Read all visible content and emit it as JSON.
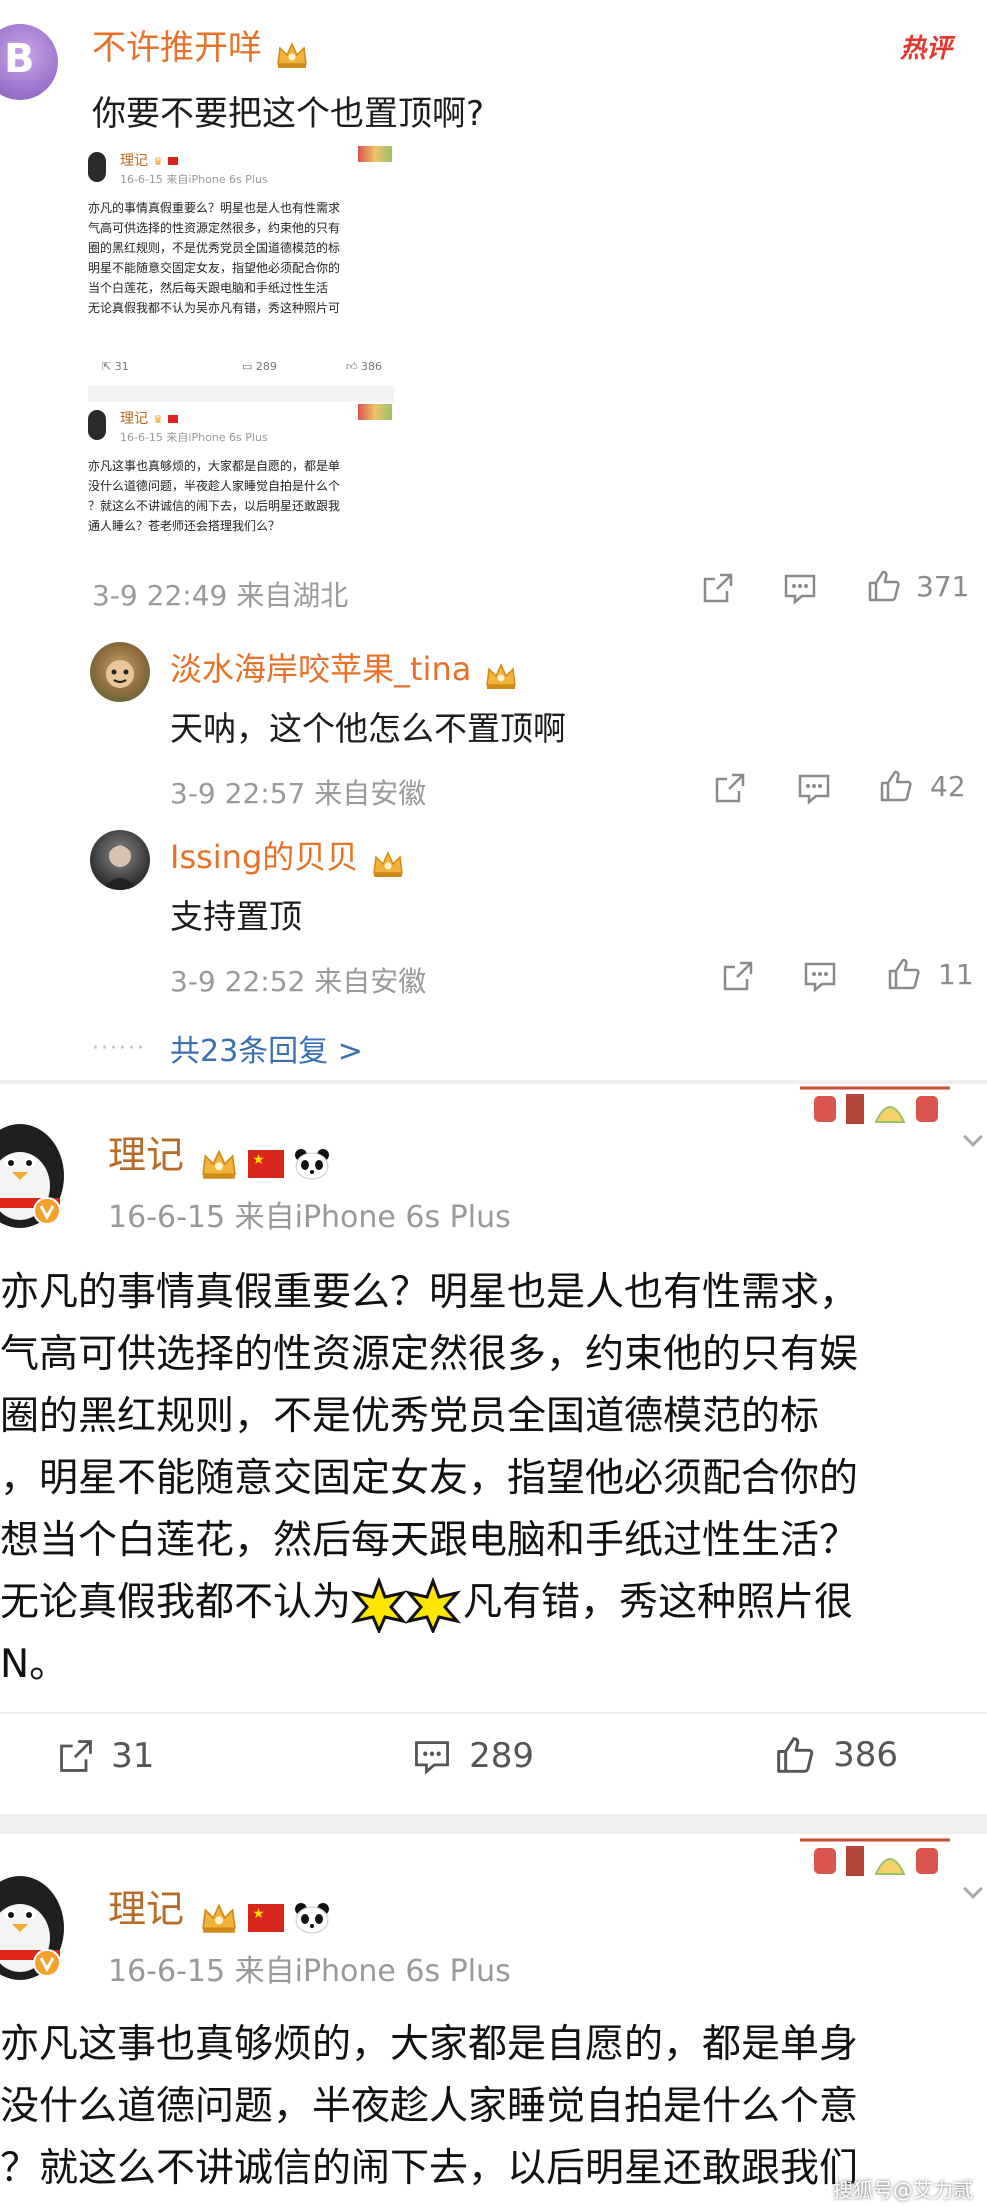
{
  "comment": {
    "avatar_letter": "B",
    "username": "不许推开咩",
    "hot_tag": "热评",
    "text": "你要不要把这个也置顶啊?",
    "meta": "3-9 22:49  来自湖北",
    "likes": "371"
  },
  "mini_posts": [
    {
      "name": "理记",
      "meta": "16-6-15  来自iPhone 6s Plus",
      "lines": [
        "亦凡的事情真假重要么？明星也是人也有性需求",
        "气高可供选择的性资源定然很多，约束他的只有",
        "圈的黑红规则，不是优秀党员全国道德模范的标",
        "明星不能随意交固定女友，指望他必须配合你的",
        "当个白莲花，然后每天跟电脑和手纸过性生活",
        "无论真假我都不认为吴亦凡有错，秀这种照片可"
      ],
      "reposts": "31",
      "comments": "289",
      "likes": "386"
    },
    {
      "name": "理记",
      "meta": "16-6-15  来自iPhone 6s Plus",
      "lines": [
        "亦凡这事也真够烦的，大家都是自愿的，都是单",
        "没什么道德问题，半夜趁人家睡觉自拍是什么个",
        "？就这么不讲诚信的闹下去，以后明星还敢跟我",
        "通人睡么？苍老师还会搭理我们么？"
      ]
    }
  ],
  "replies": [
    {
      "username": "淡水海岸咬苹果_tina",
      "text": "天呐，这个他怎么不置顶啊",
      "meta": "3-9 22:57  来自安徽",
      "likes": "42"
    },
    {
      "username": "Issing的贝贝",
      "text": "支持置顶",
      "meta": "3-9 22:52  来自安徽",
      "likes": "11"
    }
  ],
  "more_replies": "共23条回复 >",
  "more_dots": "······",
  "post1": {
    "name": "理记",
    "meta": "16-6-15  来自iPhone 6s Plus",
    "lines": [
      "亦凡的事情真假重要么？明星也是人也有性需求，",
      "气高可供选择的性资源定然很多，约束他的只有娱",
      "圈的黑红规则，不是优秀党员全国道德模范的标",
      "，明星不能随意交固定女友，指望他必须配合你的",
      "想当个白莲花，然后每天跟电脑和手纸过性生活？",
      "无论真假我都不认为",
      "凡有错，秀这种照片很",
      "N。"
    ],
    "reposts": "31",
    "comments": "289",
    "likes": "386"
  },
  "post2": {
    "name": "理记",
    "meta": "16-6-15  来自iPhone 6s Plus",
    "lines": [
      "亦凡这事也真够烦的，大家都是自愿的，都是单身",
      "没什么道德问题，半夜趁人家睡觉自拍是什么个意",
      "？就这么不讲诚信的闹下去，以后明星还敢跟我们"
    ]
  },
  "watermark": "搜狐号@艾力贰",
  "colors": {
    "username_orange": "#e8712a",
    "link_blue": "#3a6fb0",
    "hot_red": "#e2362f",
    "meta_gray": "#9a9a9a"
  }
}
